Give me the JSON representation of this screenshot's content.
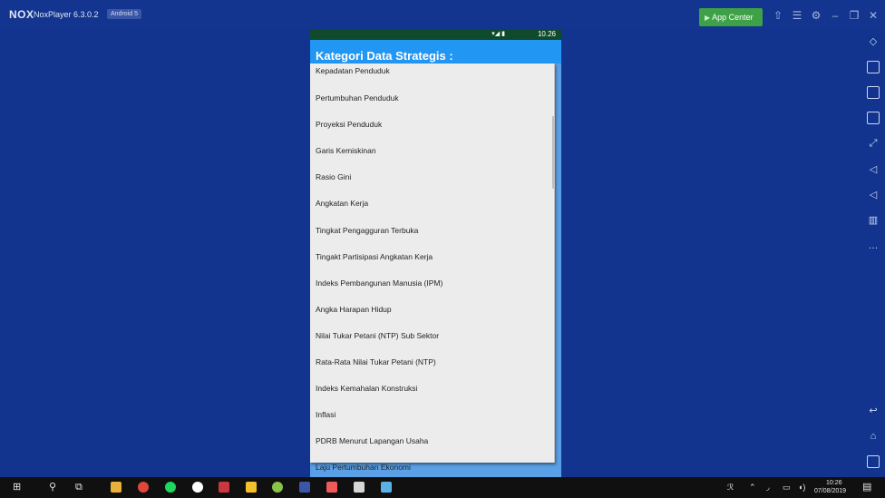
{
  "emulator": {
    "logo_text": "NOX",
    "title": "NoxPlayer 6.3.0.2",
    "android_badge": "Android 5",
    "app_center_label": "App Center"
  },
  "status_bar": {
    "time": "10.26"
  },
  "app": {
    "title": "Kategori Data Strategis :"
  },
  "list": {
    "items": [
      "Kepadatan Penduduk",
      "Pertumbuhan Penduduk",
      "Proyeksi Penduduk",
      "Garis Kemiskinan",
      "Rasio Gini",
      "Angkatan Kerja",
      "Tingkat Pengagguran Terbuka",
      "Tingakt Partisipasi Angkatan Kerja",
      "Indeks Pembangunan Manusia (IPM)",
      "Angka Harapan Hidup",
      "Nilai Tukar Petani (NTP) Sub Sektor",
      "Rata-Rata Nilai Tukar Petani (NTP)",
      "Indeks Kemahalan Konstruksi",
      "Inflasi",
      "PDRB Menurut Lapangan Usaha",
      "Laju Pertumbuhan Ekonomi"
    ]
  },
  "taskbar": {
    "clock_time": "10:26",
    "clock_date": "07/08/2019"
  },
  "colors": {
    "emulator_bg": "#12348e",
    "app_bar": "#2196f3",
    "status_bar": "#0f4a2c",
    "list_bg": "#ececec",
    "app_center": "#3fa147",
    "taskbar": "#101010"
  },
  "icons": {
    "toolbar": [
      "rotate-icon",
      "screenshot-icon",
      "display-icon",
      "apk-install-icon",
      "fullscreen-icon",
      "volume-up-icon",
      "volume-down-icon",
      "clear-icon",
      "more-icon",
      "back-icon",
      "home-icon",
      "recents-icon"
    ],
    "taskbar": [
      "windows-start-icon",
      "search-icon",
      "task-view-icon",
      "file-explorer-icon",
      "chrome-icon",
      "spotify-icon",
      "app-icon",
      "sticky-notes-icon",
      "android-studio-icon",
      "nox-icon",
      "app-icon",
      "terminal-icon",
      "notepad-icon"
    ]
  }
}
